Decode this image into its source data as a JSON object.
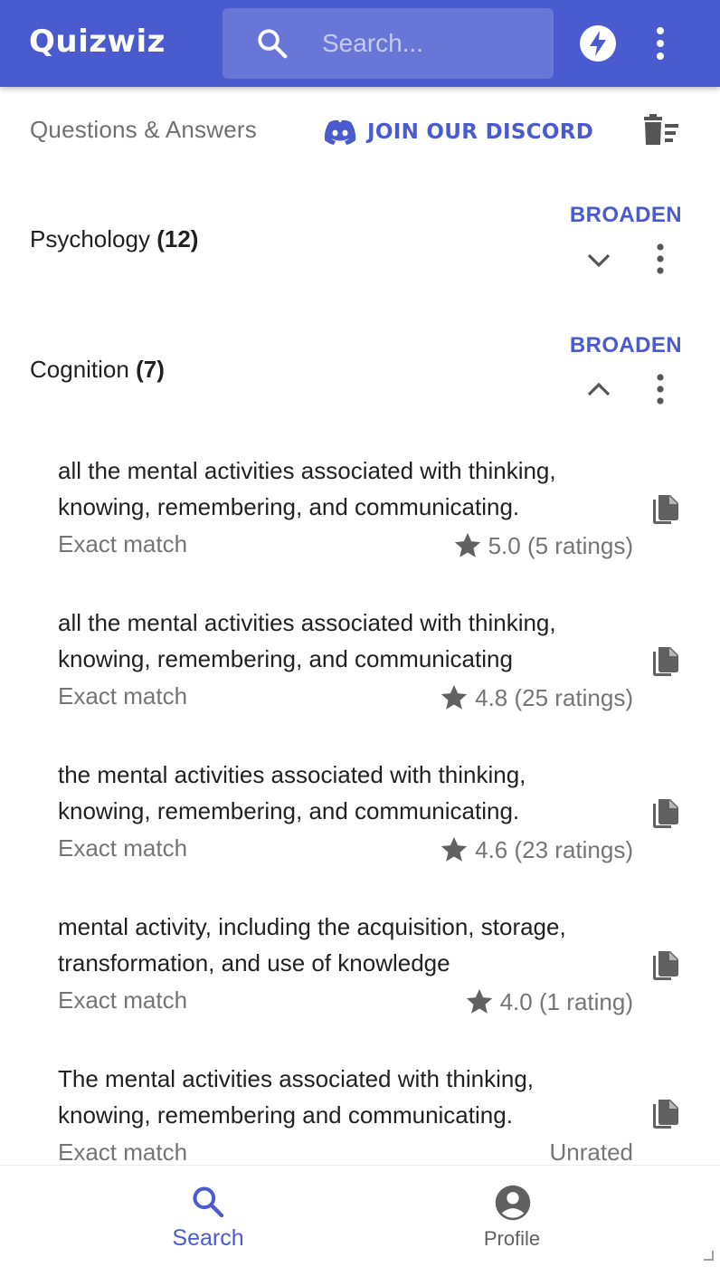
{
  "header": {
    "logo": "Quizwiz",
    "search_placeholder": "Search...",
    "brand_color": "#4a5bd0"
  },
  "subheader": {
    "title": "Questions & Answers",
    "discord_label": "JOIN OUR DISCORD"
  },
  "categories": [
    {
      "name": "Psychology",
      "count": "(12)",
      "action": "BROADEN",
      "expanded": false
    },
    {
      "name": "Cognition",
      "count": "(7)",
      "action": "BROADEN",
      "expanded": true
    }
  ],
  "answers": [
    {
      "line1": "all the mental activities associated with thinking,",
      "line2": "knowing, remembering, and communicating.",
      "match": "Exact match",
      "rating": "5.0 (5 ratings)",
      "rated": true
    },
    {
      "line1": "all the mental activities associated with thinking,",
      "line2": "knowing, remembering, and communicating",
      "match": "Exact match",
      "rating": "4.8 (25 ratings)",
      "rated": true
    },
    {
      "line1": "the mental activities associated with thinking,",
      "line2": "knowing, remembering, and communicating.",
      "match": "Exact match",
      "rating": "4.6 (23 ratings)",
      "rated": true
    },
    {
      "line1": "mental activity, including the acquisition, storage,",
      "line2": "transformation, and use of knowledge",
      "match": "Exact match",
      "rating": "4.0 (1 rating)",
      "rated": true
    },
    {
      "line1": "The mental activities associated with thinking,",
      "line2": "knowing, remembering and communicating.",
      "match": "Exact match",
      "rating": "Unrated",
      "rated": false
    }
  ],
  "bottom_nav": {
    "search_label": "Search",
    "profile_label": "Profile",
    "active": "search"
  }
}
